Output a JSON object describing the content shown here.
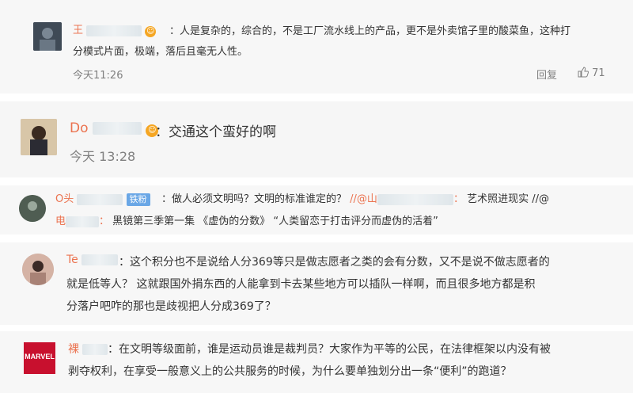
{
  "comments": [
    {
      "name": "王",
      "separator": "：",
      "text_line1": "人是复杂的，综合的，不是工厂流水线上的产品，更不是外卖馆子里的酸菜鱼，这种打",
      "text_line2": "分模式片面，极端，落后且毫无人性。",
      "time": "今天11:26",
      "reply_label": "回复",
      "like_count": "71"
    },
    {
      "name": "Do",
      "separator": "：",
      "text": "交通这个蛮好的啊",
      "time": "今天 13:28"
    },
    {
      "name": "O头",
      "badge": "铁粉",
      "separator": "：",
      "text_a": "做人必须文明吗？文明的标准谁定的？",
      "repost_prefix": "//@山",
      "repost_sep": "：",
      "text_b": "艺术照进现实 //@",
      "line2_user": "电",
      "line2_sep": "：",
      "line2_text": "黑镜第三季第一集 《虚伪的分数》 “人类留恋于打击评分而虚伪的活着”"
    },
    {
      "name": "Te",
      "separator": "：",
      "text_line1": "这个积分也不是说给人分369等只是做志愿者之类的会有分数，又不是说不做志愿者的",
      "text_line2": "就是低等人？ 这就跟国外捐东西的人能拿到卡去某些地方可以插队一样啊，而且很多地方都是积",
      "text_line3": "分落户吧咋的那也是歧视把人分成369了？"
    },
    {
      "name": "裸",
      "separator": "：",
      "text_line1": "在文明等级面前，谁是运动员谁是裁判员？大家作为平等的公民，在法律框架以内没有被",
      "text_line2": "剥夺权利，在享受一般意义上的公共服务的时候，为什么要单独划分出一条“便利”的跑道？",
      "avatar_logo": "MARVEL"
    }
  ],
  "colors": {
    "username": "#eb7350",
    "meta": "#808080",
    "card_bg": "#f7f7f7",
    "badge": "#6aa7e6",
    "marvel_red": "#c8102e"
  },
  "icons": [
    "thumbs-up-icon",
    "emoji-icon"
  ]
}
